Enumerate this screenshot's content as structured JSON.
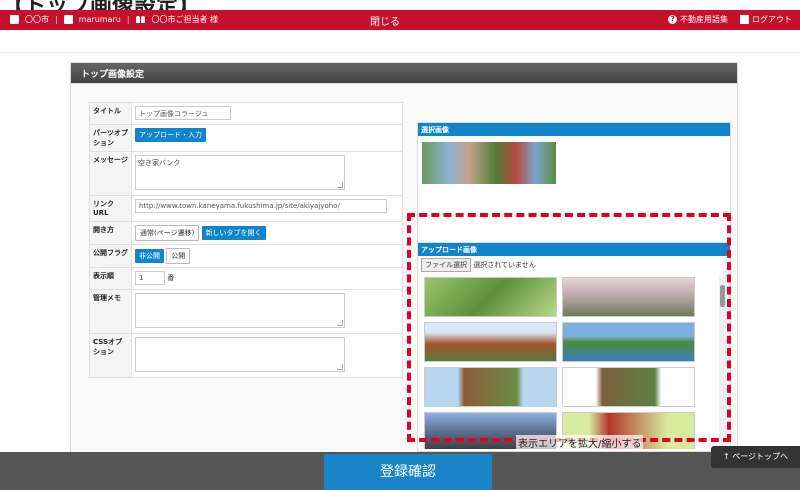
{
  "page": {
    "heading": "【トップ画像設定】"
  },
  "topbar": {
    "city": "〇〇市",
    "user": "marumaru",
    "staff": "〇〇市ご担当者 様",
    "close": "閉じる",
    "glossary": "不動産用語集",
    "logout": "ログアウト"
  },
  "panel": {
    "title": "トップ画像設定"
  },
  "form": {
    "title_label": "タイトル",
    "title_value": "トップ画像コラージュ",
    "parts_label": "パーツオプション",
    "parts_button": "アップロード・入力",
    "message_label": "メッセージ",
    "message_value": "空き家バンク",
    "link_label": "リンクURL",
    "link_value": "http://www.town.kaneyama.fukushima.jp/site/akiyajyoho/",
    "open_label": "開き方",
    "open_normal": "通常(ページ遷移)",
    "open_newtab": "新しいタブを開く",
    "flag_label": "公開フラグ",
    "flag_private": "非公開",
    "flag_public": "公開",
    "order_label": "表示順",
    "order_value": "1",
    "order_suffix": "番",
    "memo_label": "管理メモ",
    "css_label": "CSSオプション"
  },
  "selected": {
    "heading": "選択画像"
  },
  "upload": {
    "heading": "アップロード画像",
    "file_button": "ファイル選択",
    "file_status": "選択されていません",
    "expand": "表示エリアを拡大/縮小する"
  },
  "footer": {
    "confirm": "登録確認",
    "pagetop": "↑ ページトップへ"
  },
  "colors": {
    "accent_red": "#c8102e",
    "accent_blue": "#1284c9",
    "highlight_dash": "#e3001e"
  }
}
